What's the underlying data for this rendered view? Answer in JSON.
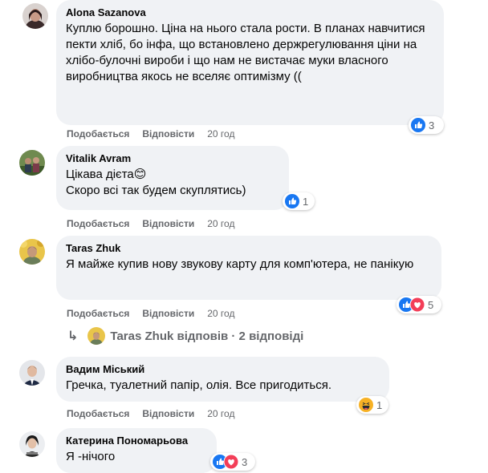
{
  "comments": [
    {
      "author": "Alona Sazanova",
      "text": "Куплю борошно. Ціна на нього стала рости. В планах навчитися пекти хліб, бо інфа, що встановлено держрегулювання ціни на хлібо-булочні вироби і що нам не вистачає муки власного виробництва якось не вселяє оптимізму ((",
      "like": "Подобається",
      "reply": "Відповісти",
      "time": "20 год",
      "reaction_count": "3"
    },
    {
      "author": "Vitalik Avram",
      "text": "Цікава дієта😊\nСкоро всі так будем скуплятись)",
      "like": "Подобається",
      "reply": "Відповісти",
      "time": "20 год",
      "reaction_count": "1"
    },
    {
      "author": "Taras Zhuk",
      "text": "Я майже купив нову звукову карту для комп'ютера, не панікую",
      "like": "Подобається",
      "reply": "Відповісти",
      "time": "20 год",
      "reaction_count": "5",
      "replies_link": "Taras Zhuk відповів · 2 відповіді"
    },
    {
      "author": "Вадим Міський",
      "text": "Гречка, туалетний папір, олія. Все пригодиться.",
      "like": "Подобається",
      "reply": "Відповісти",
      "time": "20 год",
      "reaction_count": "1"
    },
    {
      "author": "Катерина Пономарьова",
      "text": "Я -нічого",
      "reaction_count": "3"
    }
  ],
  "colors": {
    "bubble": "#f0f2f5",
    "like_blue": "#1877f2",
    "love_red": "#f33e58",
    "haha_yellow": "#f7b125",
    "meta_gray": "#65676b"
  }
}
